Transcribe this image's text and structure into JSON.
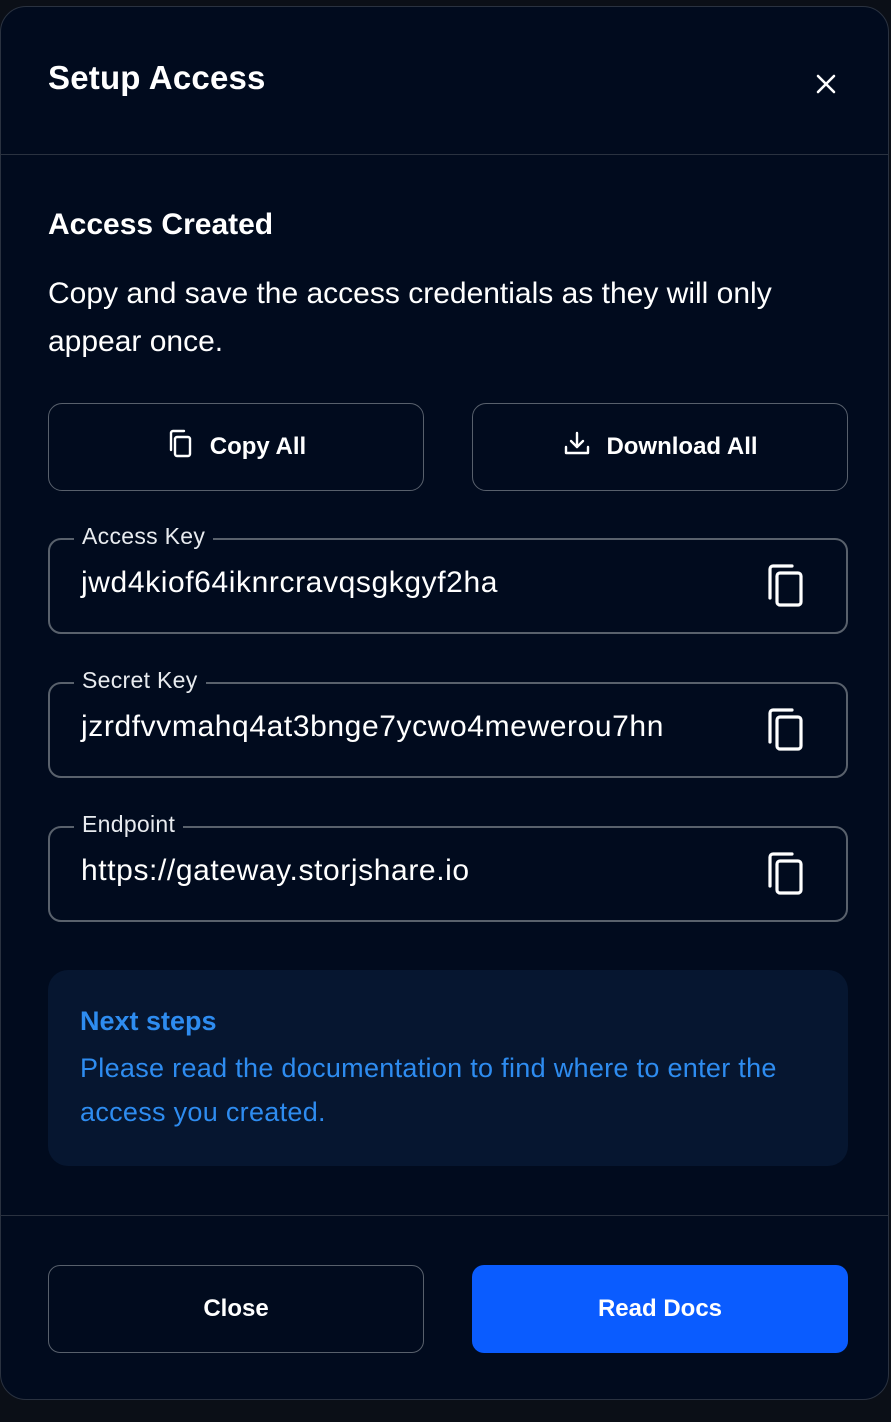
{
  "dialog": {
    "title": "Setup Access",
    "close_icon": "close-icon"
  },
  "content": {
    "heading": "Access Created",
    "description": "Copy and save the access credentials as they will only appear once.",
    "copy_all_label": "Copy All",
    "download_all_label": "Download All"
  },
  "fields": {
    "access_key": {
      "label": "Access Key",
      "value": "jwd4kiof64iknrcravqsgkgyf2ha"
    },
    "secret_key": {
      "label": "Secret Key",
      "value": "jzrdfvvmahq4at3bnge7ycwo4mewerou7hn"
    },
    "endpoint": {
      "label": "Endpoint",
      "value": "https://gateway.storjshare.io"
    }
  },
  "info": {
    "title": "Next steps",
    "text": "Please read the documentation to find where to enter the access you created."
  },
  "footer": {
    "close_label": "Close",
    "read_docs_label": "Read Docs"
  },
  "colors": {
    "background": "#010b1e",
    "accent": "#0a5cff",
    "info_text": "#2e8cf0",
    "info_bg": "#061630"
  }
}
